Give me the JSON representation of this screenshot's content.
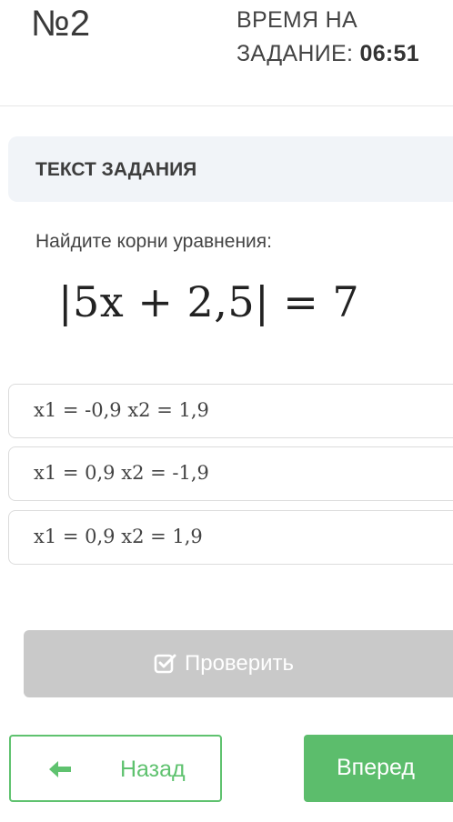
{
  "header": {
    "task_number": "№2",
    "timer_label_line1": "ВРЕМЯ НА",
    "timer_label_line2": "ЗАДАНИЕ:",
    "timer_value": "06:51"
  },
  "task": {
    "header_label": "ТЕКСТ ЗАДАНИЯ",
    "question": "Найдите корни уравнения:",
    "equation": "|5x + 2,5| = 7"
  },
  "options": [
    {
      "label": "x1 = -0,9 x2 = 1,9"
    },
    {
      "label": "x1 = 0,9 x2 = -1,9"
    },
    {
      "label": "x1 = 0,9 x2 = 1,9"
    }
  ],
  "buttons": {
    "check_label": "Проверить",
    "back_label": "Назад",
    "next_label": "Вперед"
  },
  "icons": {
    "check": "check-square-icon",
    "back": "arrow-left-icon"
  },
  "colors": {
    "accent_green": "#5cbd6c",
    "check_disabled": "#c9c9c9",
    "task_header_bg": "#f1f4f8"
  }
}
